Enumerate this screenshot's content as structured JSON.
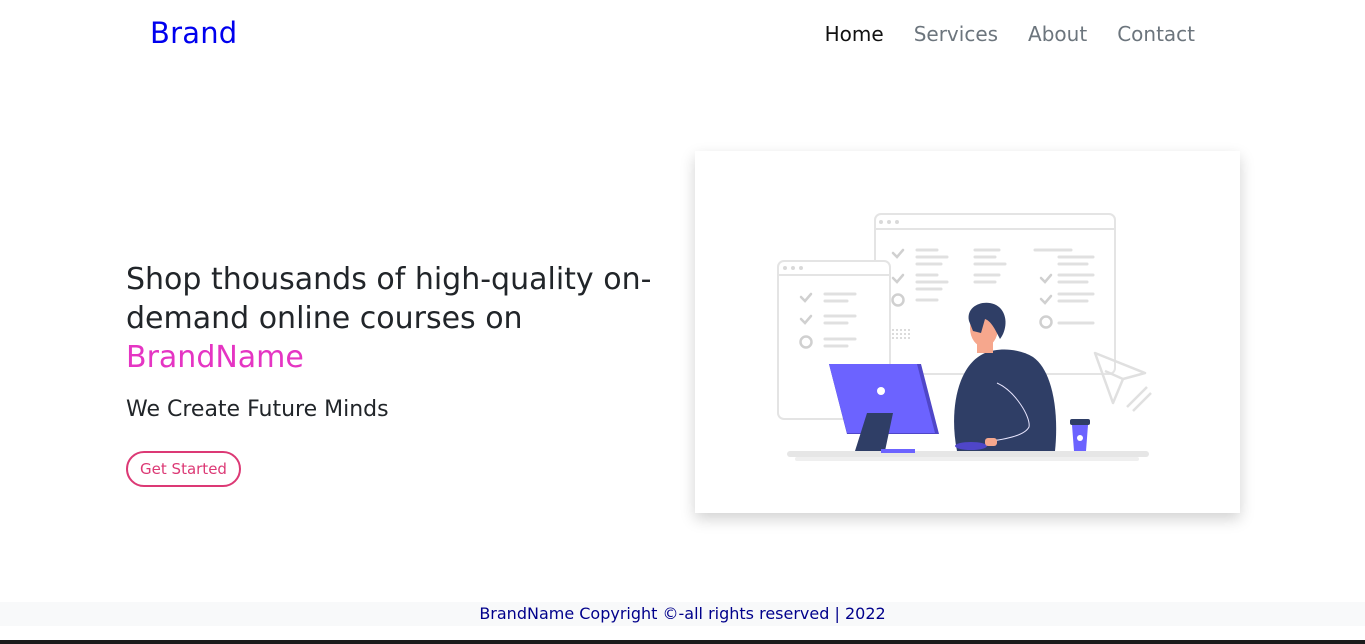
{
  "navbar": {
    "brand": "Brand",
    "links": [
      {
        "label": "Home",
        "active": true
      },
      {
        "label": "Services",
        "active": false
      },
      {
        "label": "About",
        "active": false
      },
      {
        "label": "Contact",
        "active": false
      }
    ]
  },
  "hero": {
    "heading": "Shop thousands of high-quality on-demand online courses on",
    "brand_name": "BrandName",
    "subheading": "We Create Future Minds",
    "cta_label": "Get Started"
  },
  "footer": {
    "text": "BrandName Copyright ©-all rights reserved | 2022"
  },
  "colors": {
    "brand": "#0000ee",
    "accent_pink": "#e535c3",
    "cta": "#dc3975",
    "illustration_primary": "#6c63ff",
    "person_shirt": "#2f3e66"
  }
}
